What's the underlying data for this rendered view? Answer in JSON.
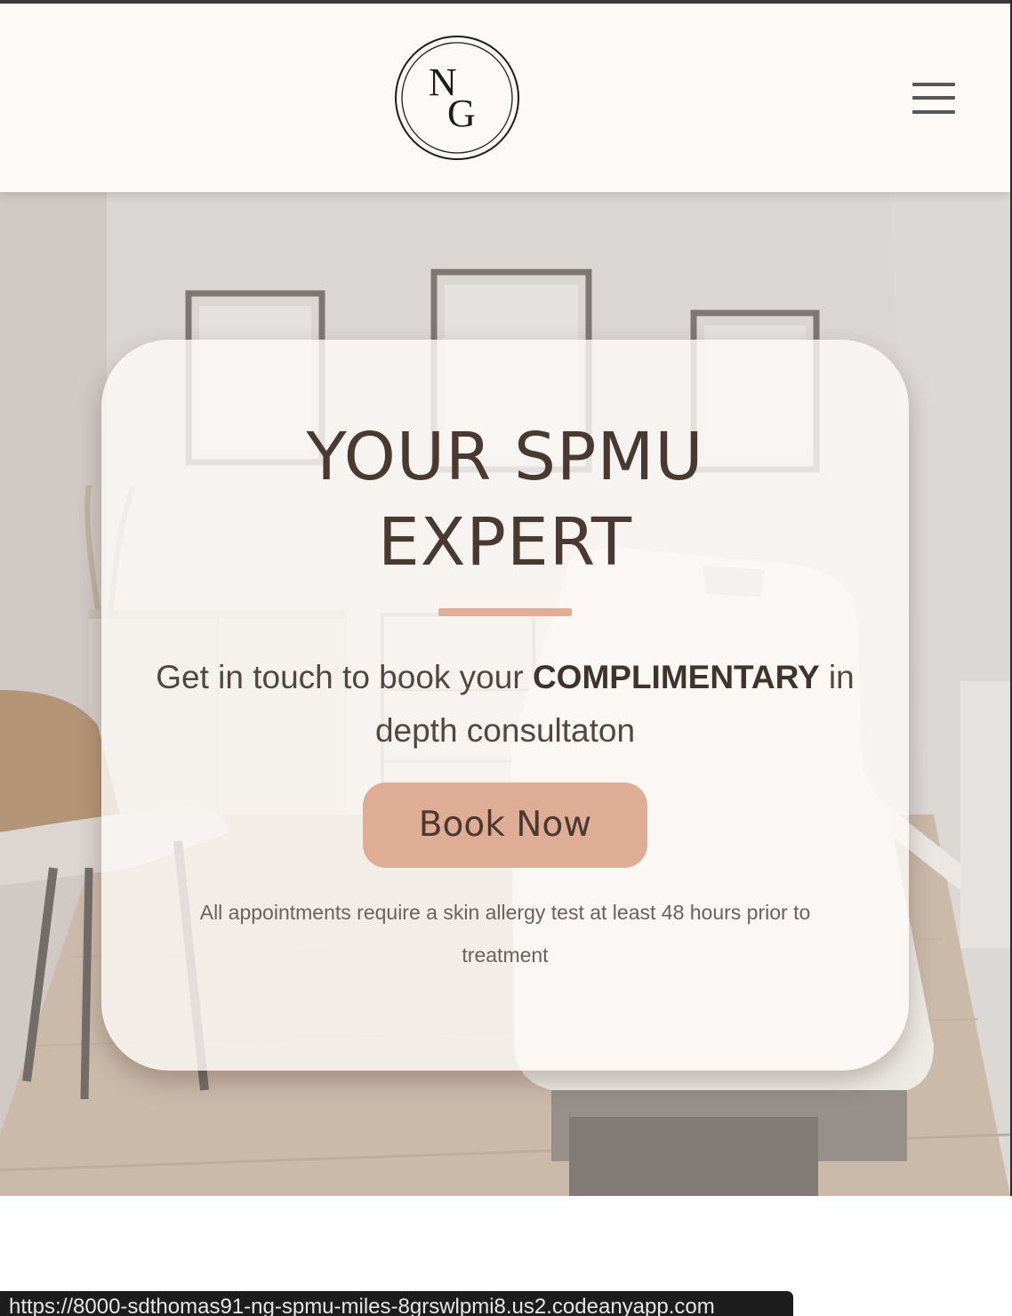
{
  "navbar": {
    "logo_letters": "NG",
    "menu_icon": "hamburger-menu-icon"
  },
  "hero": {
    "title_line1": "YOUR SPMU",
    "title_line2": "EXPERT",
    "subtitle_before": "Get in touch to book your ",
    "subtitle_emphasis": "COMPLIMENTARY",
    "subtitle_after": " in depth consultaton",
    "cta_label": "Book Now",
    "note": "All appointments require a skin allergy test at least 48 hours prior to treatment"
  },
  "status_bar": {
    "url": "https://8000-sdthomas91-ng-spmu-miles-8grswlpmi8.us2.codeanyapp.com"
  },
  "colors": {
    "navbar_bg": "#fcf9f6",
    "card_bg": "#fdfaf8",
    "accent": "#dfac96",
    "title_text": "#4a3931",
    "note_text": "#6a625d"
  }
}
